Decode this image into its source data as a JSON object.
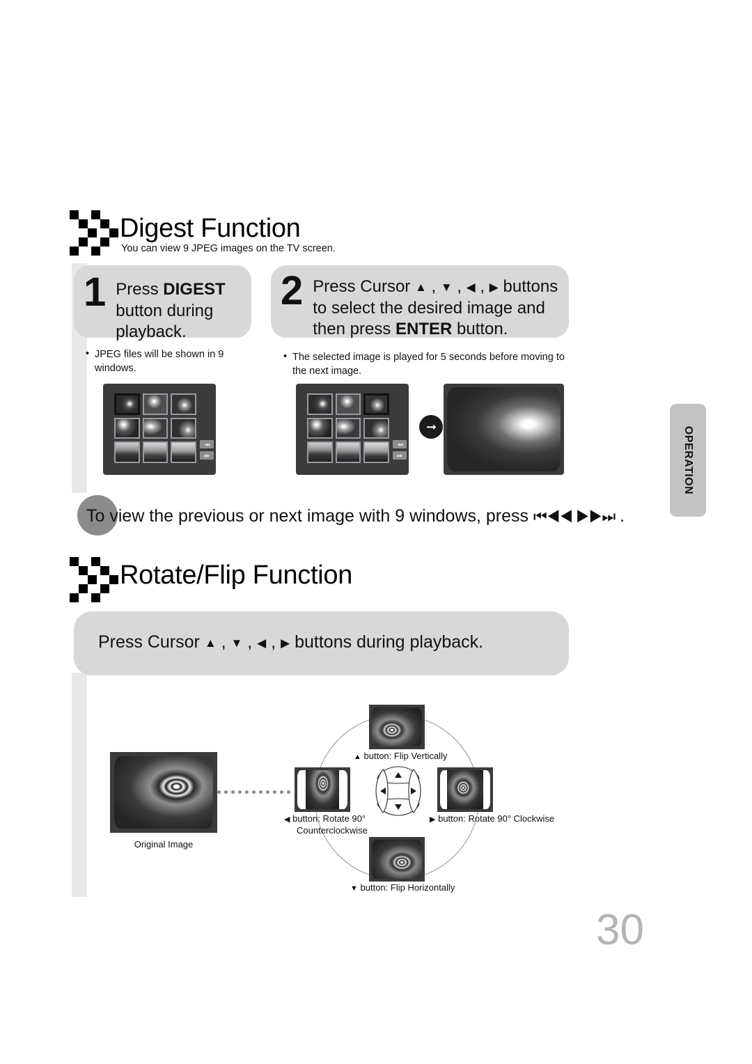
{
  "page": {
    "number": "30",
    "side_tab": "OPERATION"
  },
  "digest": {
    "title": "Digest Function",
    "subtitle": "You can view 9 JPEG images on the TV screen.",
    "logo_icon": "chequer-arrows-icon",
    "steps": [
      {
        "number": "1",
        "text_html_parts": [
          "Press ",
          "DIGEST",
          " button during playback."
        ],
        "lines": [
          "Press DIGEST",
          "button during",
          "playback."
        ],
        "bullet": "JPEG files will be shown in 9 windows."
      },
      {
        "number": "2",
        "lines": [
          "Press Cursor ▲ , ▼ , ◀ , ▶ buttons",
          "to select the desired image and",
          "then press ENTER button."
        ],
        "bullet": "The selected image is played for 5 seconds before moving to the next image."
      }
    ],
    "tv_screens": {
      "grid_label": "9-window JPEG thumbnail grid",
      "selected_cell_step1": 1,
      "selected_cell_step2": 3,
      "nav_buttons": [
        "◂◂",
        "▸▸"
      ],
      "transition_icon": "right-arrow-circle-icon",
      "result_label": "full screen kitten photo"
    },
    "note": {
      "prefix": "To",
      "text": "To view the previous or next image with 9 windows, press",
      "rest": "view the previous or next image with 9 windows, press",
      "glyphs": "⏮◀◀ ▶▶⏭",
      "suffix": "."
    }
  },
  "rotate_flip": {
    "title": "Rotate/Flip Function",
    "logo_icon": "chequer-arrows-icon",
    "banner": "Press Cursor ▲ , ▼ , ◀ , ▶ buttons during playback.",
    "original_caption": "Original Image",
    "dpad_icon": "dpad-navigation-icon",
    "nodes": {
      "top": {
        "glyph": "▲",
        "caption": "button: Flip Vertically"
      },
      "right": {
        "glyph": "▶",
        "caption": "button: Rotate 90° Clockwise"
      },
      "bottom": {
        "glyph": "▼",
        "caption": "button: Flip Horizontally"
      },
      "left": {
        "glyph": "◀",
        "caption_line1": "button: Rotate 90°",
        "caption_line2": "Counterclockwise"
      }
    }
  },
  "colors": {
    "step_box": "#d8d8d8",
    "rail": "#e8e8e8",
    "oval": "#8b8b8b",
    "side_tab": "#c3c3c3",
    "page_number": "#b4b4b4",
    "tv_bezel": "#3b3b3b"
  }
}
